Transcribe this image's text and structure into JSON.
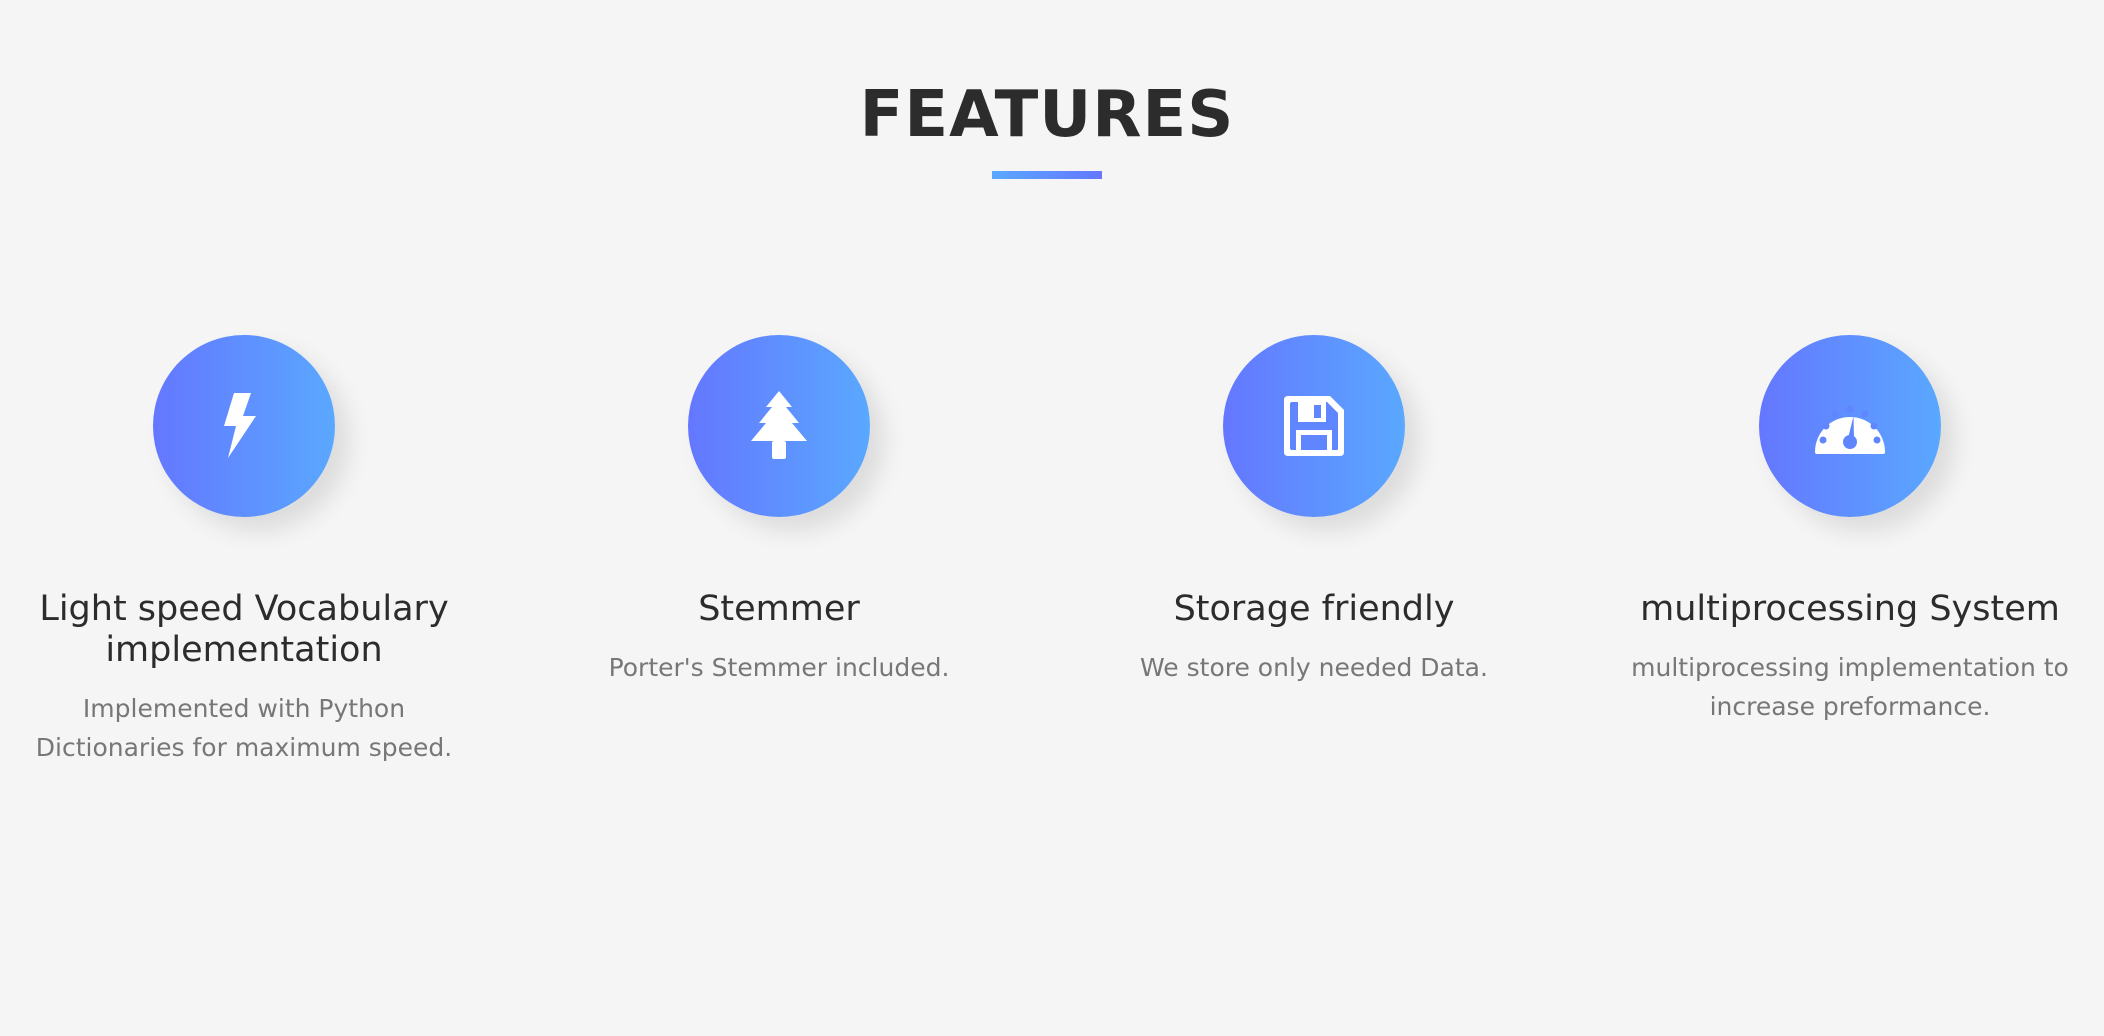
{
  "section": {
    "title": "FEATURES"
  },
  "colors": {
    "background": "#f5f5f5",
    "gradient_start": "#6477ff",
    "gradient_end": "#5aa8ff",
    "heading": "#2c2c2c",
    "body_text": "#777777"
  },
  "features": [
    {
      "icon": "lightning-bolt-icon",
      "title": "Light speed Vocabulary implementation",
      "description": "Implemented with Python Dictionaries for maximum speed."
    },
    {
      "icon": "tree-icon",
      "title": "Stemmer",
      "description": "Porter's Stemmer included."
    },
    {
      "icon": "floppy-disk-icon",
      "title": "Storage friendly",
      "description": "We store only needed Data."
    },
    {
      "icon": "speedometer-icon",
      "title": "multiprocessing System",
      "description": "multiprocessing implementation to increase preformance."
    }
  ]
}
